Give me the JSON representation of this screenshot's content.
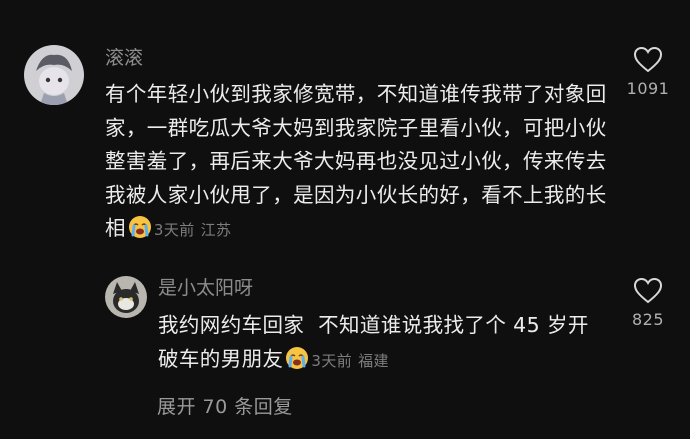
{
  "comment": {
    "username": "滚滚",
    "text": "有个年轻小伙到我家修宽带，不知道谁传我带了对象回家，一群吃瓜大爷大妈到我家院子里看小伙，可把小伙整害羞了，再后来大爷大妈再也没见过小伙，传来传去我被人家小伙甩了，是因为小伙长的好，看不上我的长相",
    "emoji": "crying-face-emoji",
    "time": "3天前",
    "location": "江苏",
    "likes": "1091"
  },
  "reply": {
    "username": "是小太阳呀",
    "text": "我约网约车回家  不知道谁说我找了个 45 岁开破车的男朋友",
    "emoji": "crying-face-emoji",
    "time": "3天前",
    "location": "福建",
    "likes": "825"
  },
  "expand_label": "展开 70 条回复",
  "colors": {
    "background": "#0f0f0f",
    "text": "#ececec",
    "username": "#8c8c8c",
    "meta": "#7d7d7d"
  }
}
